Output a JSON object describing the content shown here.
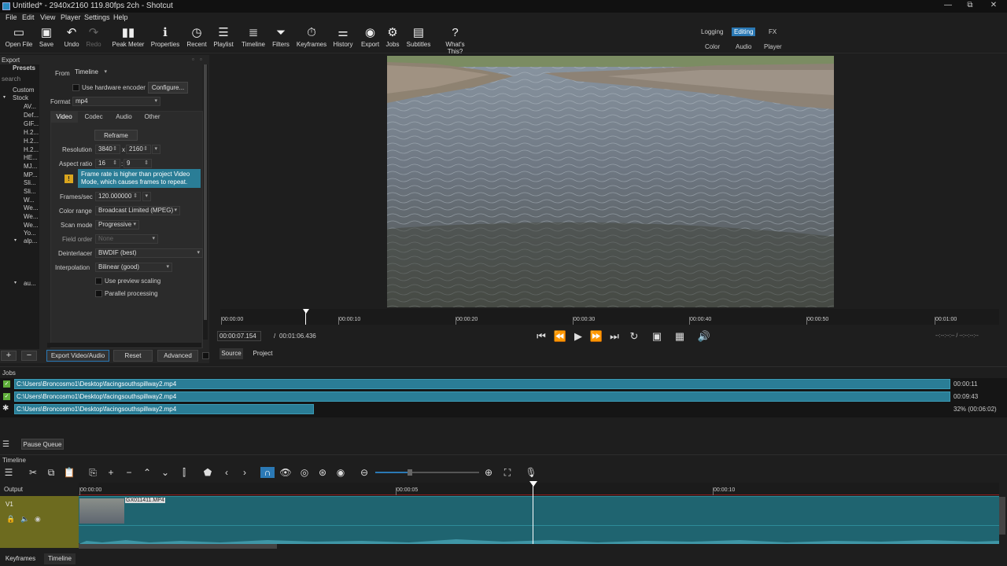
{
  "window": {
    "title": "Untitled* - 2940x2160 119.80fps 2ch - Shotcut",
    "controls": [
      "—",
      "⧉",
      "✕"
    ]
  },
  "menu": [
    "File",
    "Edit",
    "View",
    "Player",
    "Settings",
    "Help"
  ],
  "toolbar": [
    {
      "label": "Open File",
      "icon": "open-file-icon",
      "glyph": "▭"
    },
    {
      "label": "Save",
      "icon": "save-icon",
      "glyph": "💾"
    },
    {
      "label": "Undo",
      "icon": "undo-icon",
      "glyph": "↶"
    },
    {
      "label": "Redo",
      "icon": "redo-icon",
      "glyph": "↷",
      "disabled": true
    },
    {
      "label": "Peak Meter",
      "icon": "peak-meter-icon",
      "glyph": "▮▮"
    },
    {
      "label": "Properties",
      "icon": "properties-icon",
      "glyph": "ℹ"
    },
    {
      "label": "Recent",
      "icon": "recent-icon",
      "glyph": "◷"
    },
    {
      "label": "Playlist",
      "icon": "playlist-icon",
      "glyph": "☰"
    },
    {
      "label": "Timeline",
      "icon": "timeline-icon",
      "glyph": "≣"
    },
    {
      "label": "Filters",
      "icon": "filters-icon",
      "glyph": "⏷"
    },
    {
      "label": "Keyframes",
      "icon": "keyframes-icon",
      "glyph": "⏱"
    },
    {
      "label": "History",
      "icon": "history-icon",
      "glyph": "⚌"
    },
    {
      "label": "Export",
      "icon": "export-icon",
      "glyph": "◉"
    },
    {
      "label": "Jobs",
      "icon": "jobs-icon",
      "glyph": "⚙"
    },
    {
      "label": "Subtitles",
      "icon": "subtitles-icon",
      "glyph": "▤"
    },
    {
      "label": "What's This?",
      "icon": "whats-this-icon",
      "glyph": "?"
    }
  ],
  "layouts": {
    "row1": [
      "Logging",
      "Editing",
      "FX"
    ],
    "row2": [
      "Color",
      "Audio",
      "Player"
    ],
    "selected": "Editing"
  },
  "export": {
    "panel_title": "Export",
    "presets_title": "Presets",
    "search_placeholder": "search",
    "presets": [
      "Custom",
      "Stock",
      "AV...",
      "Def...",
      "GIF...",
      "H.2...",
      "H.2...",
      "H.2...",
      "HE...",
      "MJ...",
      "MP...",
      "Sli...",
      "Sli...",
      "W...",
      "We...",
      "We...",
      "We...",
      "Yo...",
      "alp...",
      "au..."
    ],
    "from_label": "From",
    "from_value": "Timeline",
    "hw_encoder_label": "Use hardware encoder",
    "configure_label": "Configure...",
    "format_label": "Format",
    "format_value": "mp4",
    "tabs": [
      "Video",
      "Codec",
      "Audio",
      "Other"
    ],
    "selected_tab": "Video",
    "reframe_label": "Reframe",
    "resolution_label": "Resolution",
    "res_w": "3840",
    "res_x": "x",
    "res_h": "2160",
    "aspect_label": "Aspect ratio",
    "aspect_w": "16",
    "aspect_colon": ":",
    "aspect_h": "9",
    "warning": "Frame rate is higher than project Video Mode, which causes frames to repeat.",
    "fps_label": "Frames/sec",
    "fps_value": "120.000000",
    "color_range_label": "Color range",
    "color_range_value": "Broadcast Limited (MPEG)",
    "scan_mode_label": "Scan mode",
    "scan_mode_value": "Progressive",
    "field_order_label": "Field order",
    "field_order_value": "None",
    "deinterlacer_label": "Deinterlacer",
    "deinterlacer_value": "BWDIF (best)",
    "interpolation_label": "Interpolation",
    "interpolation_value": "Bilinear (good)",
    "preview_scaling_label": "Use preview scaling",
    "parallel_label": "Parallel processing",
    "add_label": "+",
    "remove_label": "−",
    "export_button": "Export Video/Audio",
    "reset_button": "Reset",
    "advanced_button": "Advanced"
  },
  "player": {
    "ruler": [
      "00:00:00",
      "00:00:10",
      "00:00:20",
      "00:00:30",
      "00:00:40",
      "00:00:50",
      "00:01:00"
    ],
    "current_time": "00:00:07.154",
    "separator": "/",
    "duration": "00:01:06.436",
    "in_out": "--:--:--:-- / --:--:--:--",
    "tabs": [
      "Source",
      "Project"
    ]
  },
  "jobs": {
    "title": "Jobs",
    "items": [
      {
        "path": "C:\\Users\\Broncosmo1\\Desktop\\facingsouthspillway2.mp4",
        "time": "00:00:11",
        "progress": 1.0,
        "status": "done"
      },
      {
        "path": "C:\\Users\\Broncosmo1\\Desktop\\facingsouthspillway2.mp4",
        "time": "00:09:43",
        "progress": 1.0,
        "status": "done"
      },
      {
        "path": "C:\\Users\\Broncosmo1\\Desktop\\facingsouthspillway2.mp4",
        "time": "32% (00:06:02)",
        "progress": 0.32,
        "status": "running"
      }
    ],
    "menu_label": "☰",
    "pause_queue": "Pause Queue"
  },
  "timeline": {
    "title": "Timeline",
    "output_label": "Output",
    "ruler": [
      "00:00:00",
      "00:00:05",
      "00:00:10"
    ],
    "track_name": "V1",
    "clip_name": "GX011411.MP4"
  },
  "bottom_tabs": [
    "Keyframes",
    "Timeline"
  ],
  "colors": {
    "accent": "#2b79b5",
    "job_bar": "#2a7d96",
    "track": "#1f6470",
    "track_header": "#6d6b1f",
    "warning_bg": "#2a7d96"
  }
}
